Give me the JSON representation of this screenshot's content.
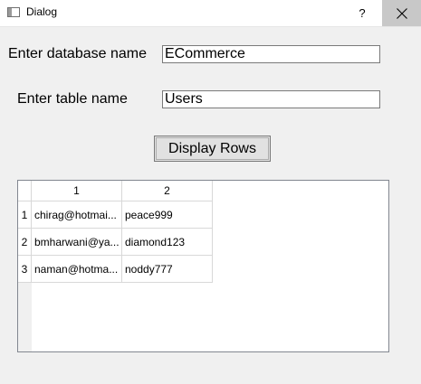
{
  "window": {
    "title": "Dialog",
    "help_label": "?"
  },
  "form": {
    "database_label": "Enter database name",
    "database_value": "ECommerce",
    "table_label": "Enter table name",
    "table_value": "Users",
    "display_button_label": "Display Rows"
  },
  "table": {
    "columns": [
      "1",
      "2"
    ],
    "row_headers": [
      "1",
      "2",
      "3"
    ],
    "rows": [
      [
        "chirag@hotmai...",
        "peace999"
      ],
      [
        "bmharwani@ya...",
        "diamond123"
      ],
      [
        "naman@hotma...",
        "noddy777"
      ]
    ]
  }
}
